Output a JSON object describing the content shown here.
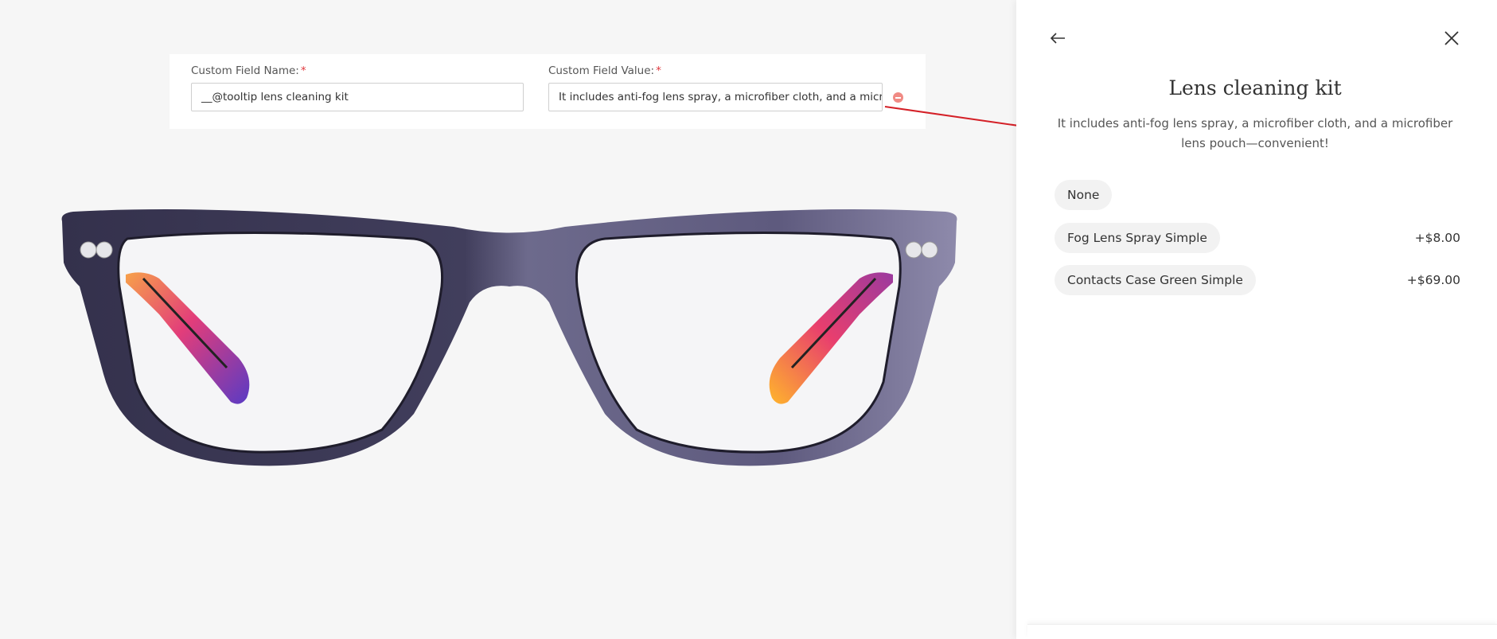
{
  "form": {
    "name_label": "Custom Field Name:",
    "name_value": "__@tooltip lens cleaning kit",
    "value_label": "Custom Field Value:",
    "value_value": "It includes anti-fog lens spray, a microfiber cloth, and a microfib",
    "required_mark": "*"
  },
  "panel": {
    "title": "Lens cleaning kit",
    "description": "It includes anti-fog lens spray, a microfiber cloth, and a microfiber lens pouch—convenient!",
    "back_icon": "arrow-left-icon",
    "close_icon": "close-icon",
    "options": [
      {
        "label": "None",
        "price": ""
      },
      {
        "label": "Fog Lens Spray Simple",
        "price": "+$8.00"
      },
      {
        "label": "Contacts Case Green Simple",
        "price": "+$69.00"
      }
    ]
  },
  "colors": {
    "accent_red": "#d42027",
    "frame": "#3d3a56",
    "required": "#e0393e"
  }
}
